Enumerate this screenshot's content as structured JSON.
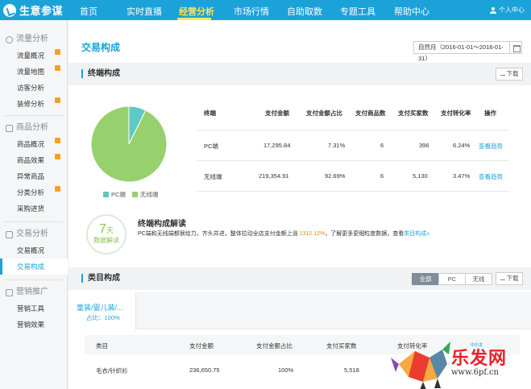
{
  "app": {
    "name": "生意参谋"
  },
  "nav": {
    "items": [
      "首页",
      "实时直播",
      "经营分析",
      "市场行情",
      "自助取数",
      "专题工具",
      "帮助中心"
    ],
    "active": "经营分析",
    "user_label": "个人中心"
  },
  "sidebar": {
    "groups": [
      {
        "title": "流量分析",
        "items": [
          "流量概况",
          "流量地图",
          "访客分析",
          "装修分析"
        ]
      },
      {
        "title": "商品分析",
        "items": [
          "商品概况",
          "商品效果",
          "异常商品",
          "分类分析",
          "采购进货"
        ]
      },
      {
        "title": "交易分析",
        "items": [
          "交易概况",
          "交易构成"
        ]
      },
      {
        "title": "营销推广",
        "items": [
          "营销工具",
          "营销效果"
        ]
      }
    ],
    "active_item": "交易构成"
  },
  "page": {
    "title": "交易构成",
    "date_range": "自然月（2016-01-01～2016-01-31）"
  },
  "terminal_section": {
    "title": "终端构成",
    "download_label": "下载",
    "legend": [
      {
        "label": "PC端",
        "color": "#5bc9c4"
      },
      {
        "label": "无线端",
        "color": "#97d16e"
      }
    ],
    "pie": [
      {
        "label": "PC端",
        "value": 7.31,
        "color": "#5bc9c4"
      },
      {
        "label": "无线端",
        "value": 92.69,
        "color": "#97d16e"
      }
    ],
    "table": {
      "headers": [
        "终端",
        "支付金额",
        "支付金额占比",
        "支付商品数",
        "支付买家数",
        "支付转化率",
        "操作"
      ],
      "rows": [
        {
          "terminal": "PC端",
          "amount": "17,295.84",
          "ratio": "7.31%",
          "items": "6",
          "buyers": "396",
          "conversion": "6.24%",
          "action": "查看趋势"
        },
        {
          "terminal": "无线端",
          "amount": "219,354.91",
          "ratio": "92.69%",
          "items": "6",
          "buyers": "5,130",
          "conversion": "3.47%",
          "action": "查看趋势"
        }
      ]
    }
  },
  "interpretation": {
    "badge_num": "7",
    "badge_unit": "天",
    "badge_label": "数据解读",
    "title": "终端构成解读",
    "text_before": "PC端和无线端都很给力，齐头并进，整体拉动全店支付金额上涨",
    "highlight": "1312.12%",
    "text_after": "，了解更多更细粒度数据，查看",
    "link": "类目构成»"
  },
  "category_section": {
    "title": "类目构成",
    "filters": [
      "全部",
      "PC",
      "无线"
    ],
    "active_filter": "全部",
    "download_label": "下载",
    "tab_title": "童装/婴儿装/...",
    "tab_ratio": "占比：100%",
    "table": {
      "headers": [
        "类目",
        "支付金额",
        "支付金额占比",
        "支付买家数",
        "支付转化率"
      ],
      "rows": [
        {
          "category": "毛衣/针织衫",
          "amount": "236,650.75",
          "ratio": "100%",
          "buyers": "5,518",
          "conversion": ""
        }
      ]
    }
  },
  "watermark": {
    "brand": "乐发网",
    "url": "www.6pf.cn",
    "small": "中乐发"
  }
}
